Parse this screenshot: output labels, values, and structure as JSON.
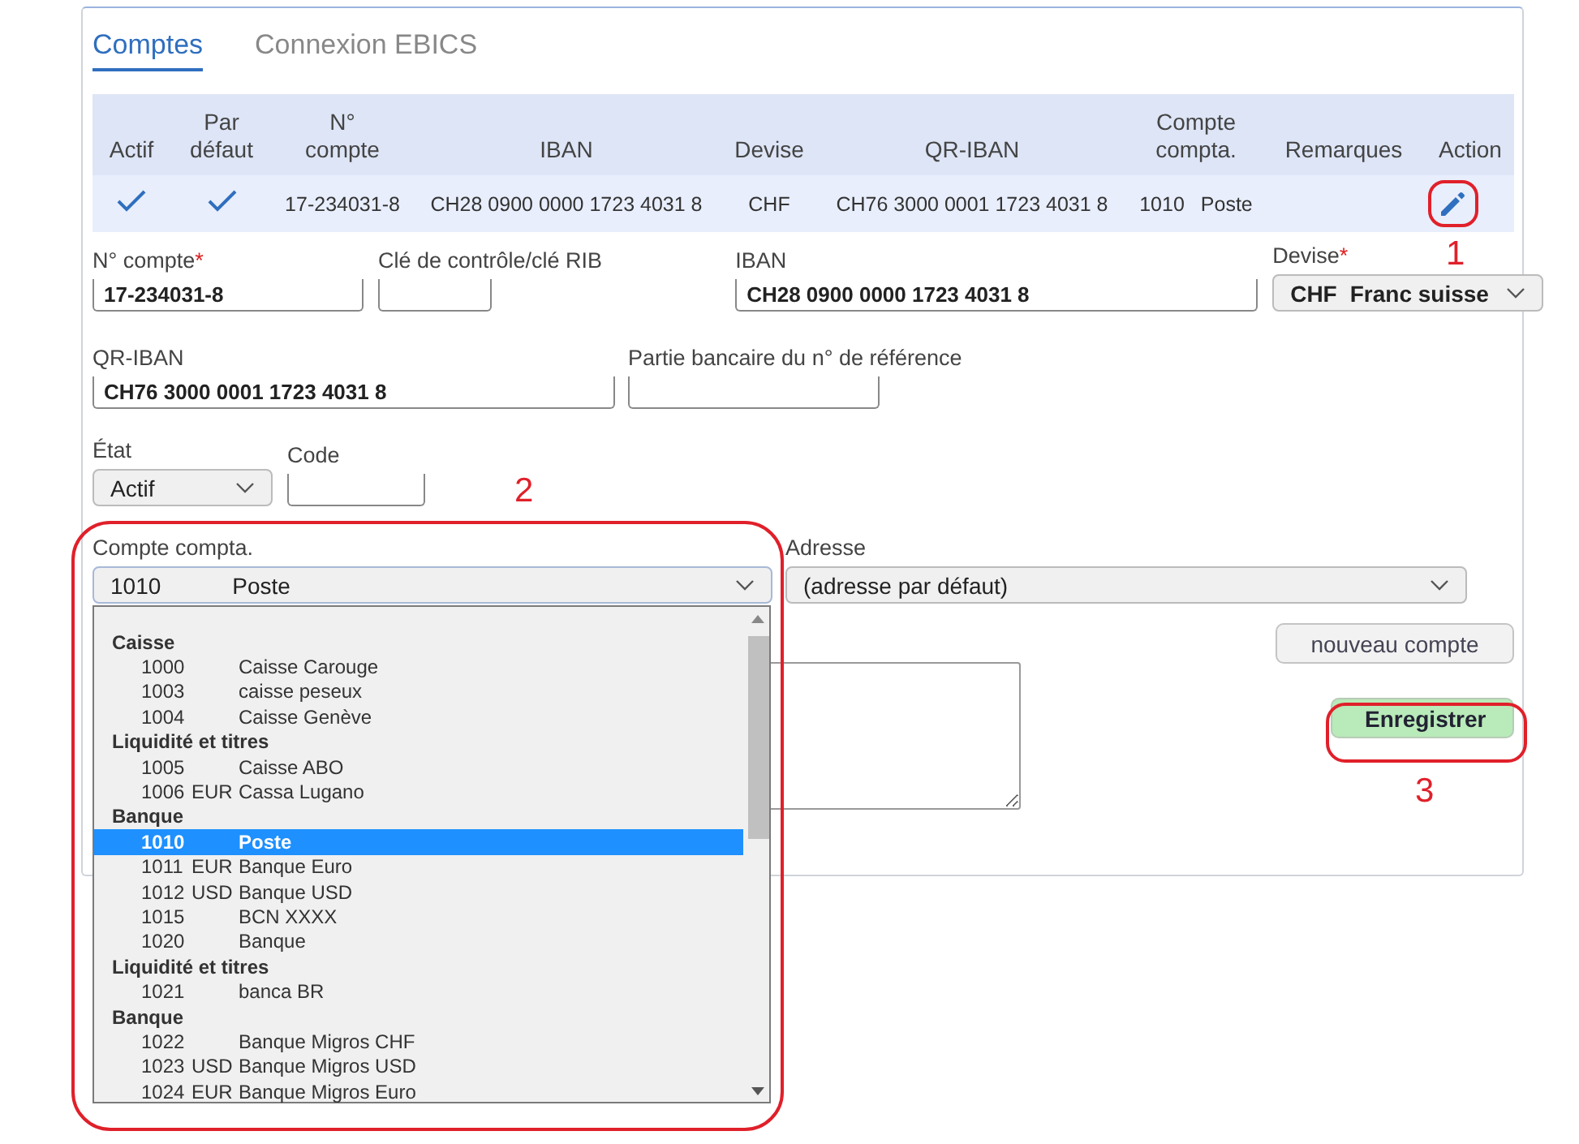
{
  "tabs": [
    {
      "label": "Comptes",
      "selected": true
    },
    {
      "label": "Connexion EBICS",
      "selected": false
    }
  ],
  "table": {
    "columns": [
      "Actif",
      "Par\ndéfaut",
      "N°\ncompte",
      "IBAN",
      "Devise",
      "QR-IBAN",
      "Compte\ncompta.",
      "Remarques",
      "Action"
    ],
    "rows": [
      {
        "actif": true,
        "par_defaut": true,
        "numero": "17-234031-8",
        "iban": "CH28 0900 0000 1723 4031 8",
        "devise": "CHF",
        "qr_iban": "CH76 3000 0001 1723 4031 8",
        "compte_compta": "1010",
        "compte_compta_name": "Poste",
        "selected": true
      }
    ]
  },
  "form": {
    "rows": [
      [
        {
          "kind": "input",
          "label": "N° compte",
          "required_mark": "*",
          "value": "17-234031-8"
        },
        {
          "kind": "input",
          "label": "Clé de contrôle/clé RIB"
        },
        {
          "kind": "input",
          "label": "IBAN",
          "value": "CH28 0900 0000 1723 4031 8"
        },
        {
          "kind": "select",
          "label": "Devise",
          "required_mark": "*",
          "value": "CHF",
          "value_detail": "Franc suisse"
        }
      ],
      [
        {
          "kind": "input",
          "label": "QR-IBAN",
          "value": "CH76 3000 0001 1723 4031 8"
        },
        {
          "kind": "input",
          "label": "Partie bancaire du n° de référence"
        }
      ],
      [
        {
          "kind": "select",
          "label": "État",
          "value": "Actif"
        },
        {
          "kind": "input",
          "label": "Code"
        }
      ],
      [
        {
          "kind": "select",
          "label": "Compte compta.",
          "value": "1010",
          "value_detail": "Poste",
          "expanded": true
        },
        {
          "kind": "select",
          "label": "Adresse",
          "value": "(adresse par défaut)"
        }
      ]
    ],
    "buttons": [
      {
        "label": "nouveau compte",
        "kind": "secondary"
      },
      {
        "label": "Enregistrer",
        "kind": "primary"
      }
    ]
  },
  "dropdown": {
    "options": [
      {
        "kind": "group",
        "name": "Caisse"
      },
      {
        "kind": "option",
        "number": "1000",
        "name": "Caisse Carouge",
        "selected": false
      },
      {
        "kind": "option",
        "number": "1003",
        "name": "caisse peseux",
        "selected": false
      },
      {
        "kind": "option",
        "number": "1004",
        "name": "Caisse Genève",
        "selected": false
      },
      {
        "kind": "group",
        "name": "Liquidité et titres"
      },
      {
        "kind": "option",
        "number": "1005",
        "name": "Caisse ABO",
        "selected": false
      },
      {
        "kind": "option",
        "number": "1006",
        "currency": "EUR",
        "name": "Cassa Lugano",
        "selected": false
      },
      {
        "kind": "group",
        "name": "Banque"
      },
      {
        "kind": "option",
        "number": "1010",
        "name": "Poste",
        "selected": true
      },
      {
        "kind": "option",
        "number": "1011",
        "currency": "EUR",
        "name": "Banque Euro",
        "selected": false
      },
      {
        "kind": "option",
        "number": "1012",
        "currency": "USD",
        "name": "Banque USD",
        "selected": false
      },
      {
        "kind": "option",
        "number": "1015",
        "name": "BCN XXXX",
        "selected": false
      },
      {
        "kind": "option",
        "number": "1020",
        "name": "Banque",
        "selected": false
      },
      {
        "kind": "group",
        "name": "Liquidité et titres"
      },
      {
        "kind": "option",
        "number": "1021",
        "name": "banca BR",
        "selected": false
      },
      {
        "kind": "group",
        "name": "Banque"
      },
      {
        "kind": "option",
        "number": "1022",
        "name": "Banque Migros CHF",
        "selected": false
      },
      {
        "kind": "option",
        "number": "1023",
        "currency": "USD",
        "name": "Banque Migros USD",
        "selected": false
      },
      {
        "kind": "option",
        "number": "1024",
        "currency": "EUR",
        "name": "Banque Migros Euro",
        "selected": false
      }
    ]
  },
  "annotations": [
    {
      "label": "1"
    },
    {
      "label": "2"
    },
    {
      "label": "3"
    }
  ]
}
